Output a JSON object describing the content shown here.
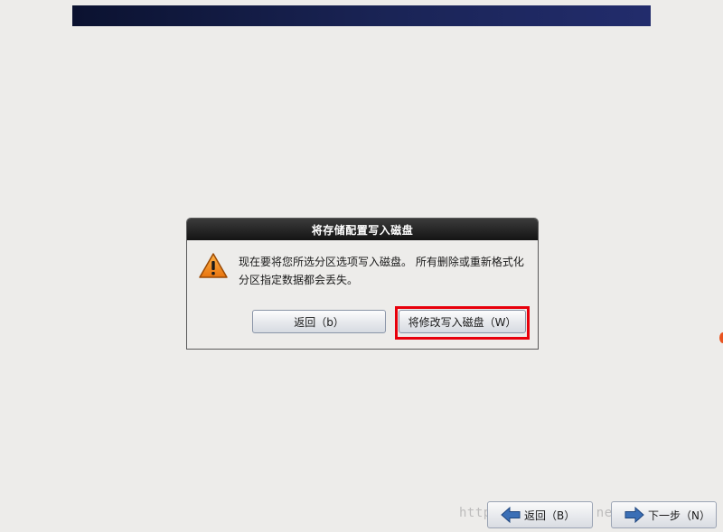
{
  "dialog": {
    "title": "将存储配置写入磁盘",
    "message": "现在要将您所选分区选项写入磁盘。 所有删除或重新格式化分区指定数据都会丢失。",
    "back_button_label": "返回（b）",
    "write_button_label": "将修改写入磁盘（W）"
  },
  "navigation": {
    "back_label": "返回（B）",
    "next_label": "下一步（N）"
  },
  "watermark": {
    "text": "http://blog.csdn.net/...g"
  },
  "colors": {
    "banner": "#1a2456",
    "titlebar": "#1e1e1e",
    "highlight": "#e8000b",
    "warning": "#f08a1c",
    "arrow": "#3b6fb6"
  },
  "icons": {
    "dialog": "warning-icon",
    "nav_back": "arrow-left-icon",
    "nav_next": "arrow-right-icon"
  }
}
